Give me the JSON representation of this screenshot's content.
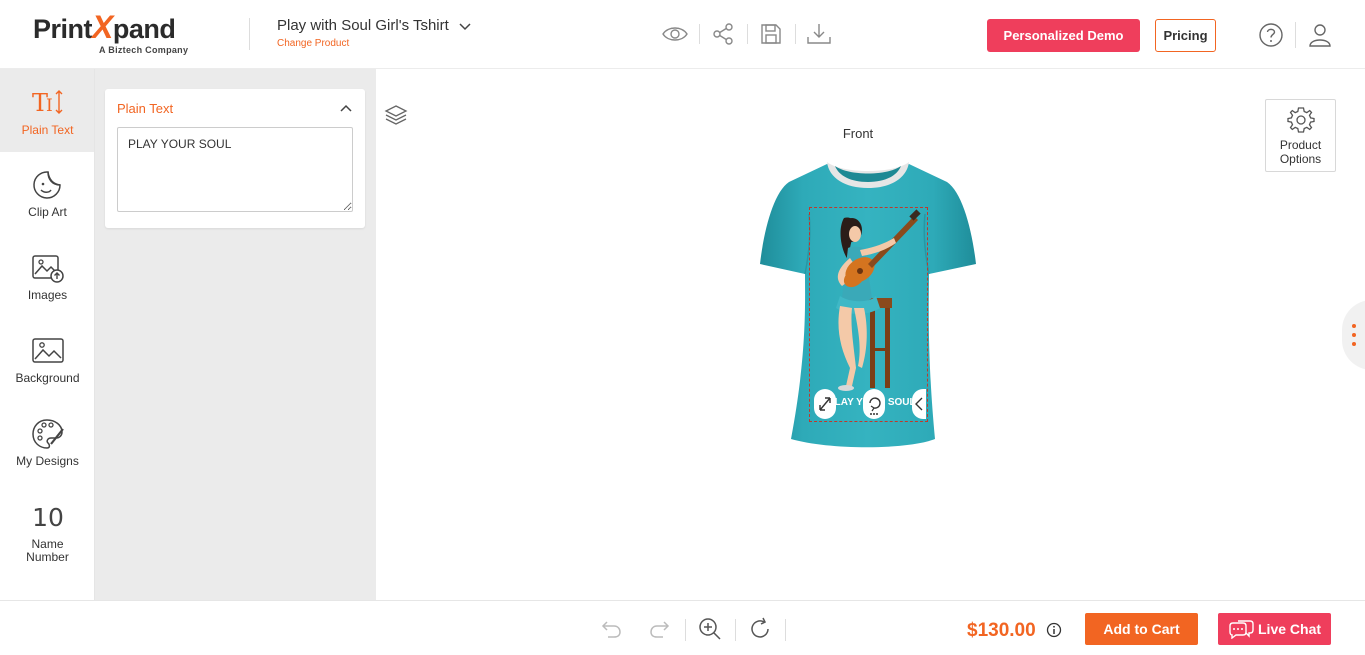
{
  "header": {
    "logo_text_a": "Print",
    "logo_text_x": "X",
    "logo_text_b": "pand",
    "logo_tagline": "A Biztech Company",
    "product_title": "Play with Soul Girl's Tshirt",
    "change_product": "Change Product",
    "demo_label": "Personalized Demo",
    "pricing_label": "Pricing",
    "icons": [
      "eye-icon",
      "share-icon",
      "save-icon",
      "download-icon",
      "help-icon",
      "user-icon"
    ]
  },
  "sidebar": {
    "items": [
      {
        "label": "Plain Text",
        "icon": "text-icon",
        "active": true
      },
      {
        "label": "Clip Art",
        "icon": "clipart-icon"
      },
      {
        "label": "Images",
        "icon": "image-upload-icon"
      },
      {
        "label": "Background",
        "icon": "background-icon"
      },
      {
        "label": "My Designs",
        "icon": "palette-icon"
      },
      {
        "label": "Name Number",
        "icon": "number-icon",
        "glyph": "10"
      }
    ]
  },
  "panel": {
    "title": "Plain Text",
    "text_value": "PLAY YOUR SOUL"
  },
  "canvas": {
    "view_label": "Front",
    "print_text": "PLAY YOUR SOUL",
    "product_options_label": "Product Options",
    "shirt_color": "#2ea8b6"
  },
  "footer": {
    "price": "$130.00",
    "add_to_cart": "Add to Cart",
    "live_chat": "Live Chat"
  },
  "colors": {
    "accent": "#f26522",
    "brand_pink": "#ef3e5c"
  }
}
